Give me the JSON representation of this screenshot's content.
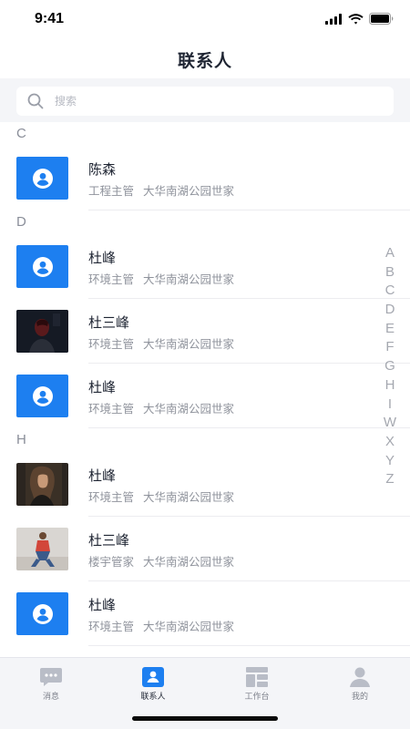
{
  "status_bar": {
    "time": "9:41"
  },
  "header": {
    "title": "联系人"
  },
  "search": {
    "placeholder": "搜索"
  },
  "sections": [
    {
      "letter": "C",
      "contacts": [
        {
          "name": "陈森",
          "role": "工程主管",
          "community": "大华南湖公园世家",
          "avatar": "default-person-icon"
        }
      ]
    },
    {
      "letter": "D",
      "contacts": [
        {
          "name": "杜峰",
          "role": "环境主管",
          "community": "大华南湖公园世家",
          "avatar": "default-person-icon"
        },
        {
          "name": "杜三峰",
          "role": "环境主管",
          "community": "大华南湖公园世家",
          "avatar": "photo-dark"
        },
        {
          "name": "杜峰",
          "role": "环境主管",
          "community": "大华南湖公园世家",
          "avatar": "default-person-icon"
        }
      ]
    },
    {
      "letter": "H",
      "contacts": [
        {
          "name": "杜峰",
          "role": "环境主管",
          "community": "大华南湖公园世家",
          "avatar": "photo-portrait"
        },
        {
          "name": "杜三峰",
          "role": "楼宇管家",
          "community": "大华南湖公园世家",
          "avatar": "photo-sitting"
        },
        {
          "name": "杜峰",
          "role": "环境主管",
          "community": "大华南湖公园世家",
          "avatar": "default-person-icon"
        }
      ]
    }
  ],
  "alpha_index": [
    "A",
    "B",
    "C",
    "D",
    "E",
    "F",
    "G",
    "H",
    "I",
    "W",
    "X",
    "Y",
    "Z"
  ],
  "tabs": [
    {
      "label": "消息",
      "icon": "message-icon",
      "active": false
    },
    {
      "label": "联系人",
      "icon": "contacts-icon",
      "active": true
    },
    {
      "label": "工作台",
      "icon": "workbench-icon",
      "active": false
    },
    {
      "label": "我的",
      "icon": "profile-icon",
      "active": false
    }
  ],
  "colors": {
    "accent": "#1d7ff0",
    "tab_inactive": "#b9bdc7",
    "background_gray": "#f4f5f8"
  }
}
